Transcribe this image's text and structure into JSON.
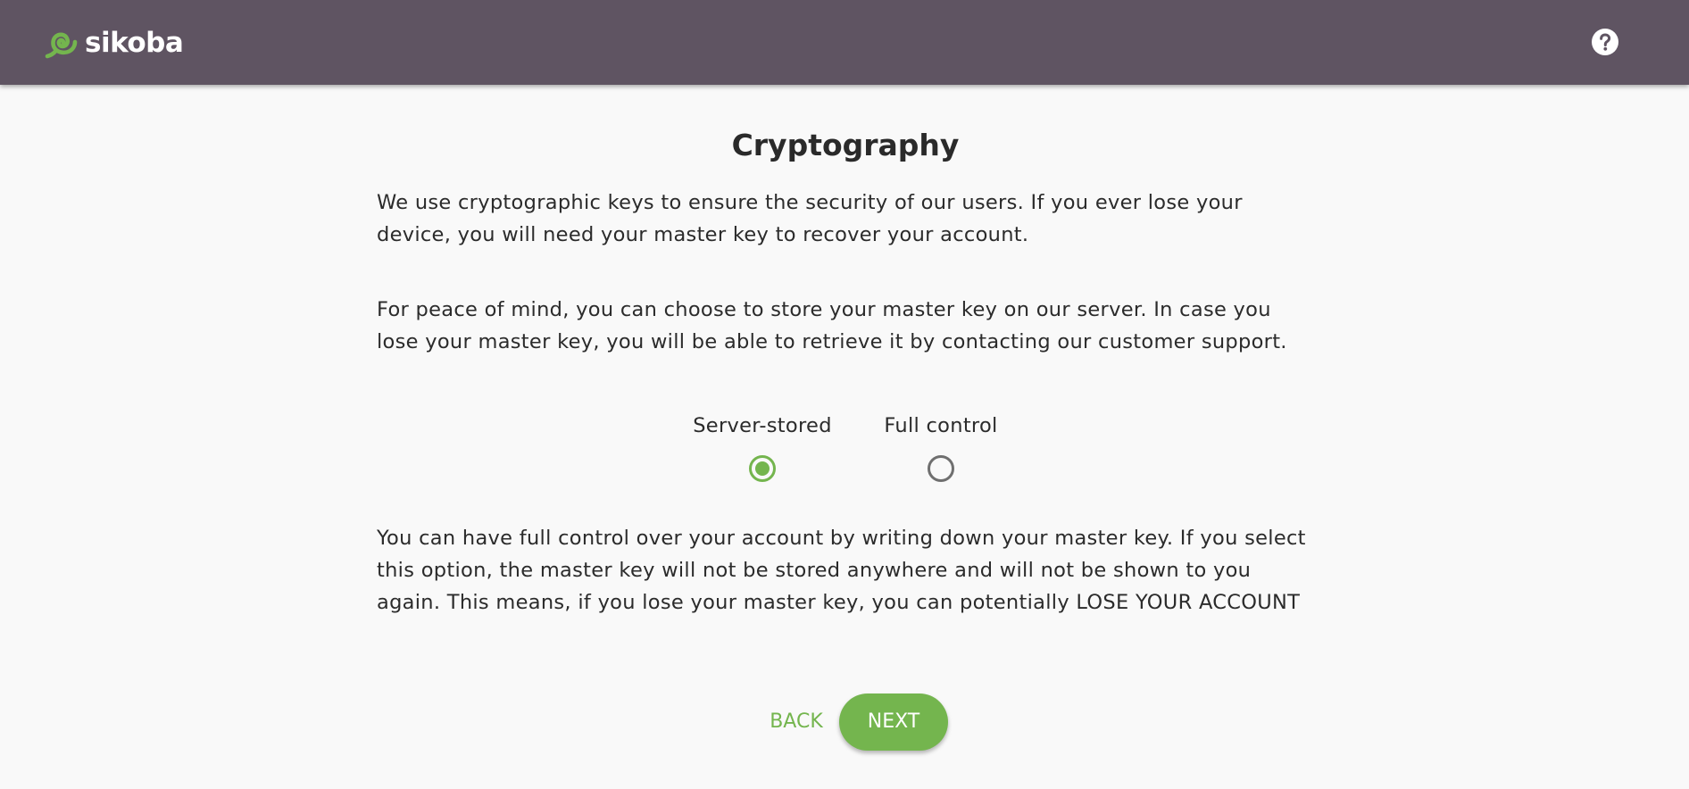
{
  "header": {
    "brand_name": "sikoba",
    "logo_icon": "swirl-logo-icon",
    "help_icon": "help-circle-icon"
  },
  "colors": {
    "appbar": "#5f5462",
    "accent": "#74b54e",
    "background": "#f9f9f9",
    "text": "#2b2b2b"
  },
  "main": {
    "title": "Cryptography",
    "intro": "We use cryptographic keys to ensure the security of our users. If you ever lose your device, you will need your master key to recover your account.",
    "server_info": "For peace of mind, you can choose to store your master key on our server. In case you lose your master key, you will be able to retrieve it by contacting our customer support.",
    "options": [
      {
        "label": "Server-stored",
        "selected": true
      },
      {
        "label": "Full control",
        "selected": false
      }
    ],
    "full_control_info": "You can have full control over your account by writing down your master key. If you select this option, the master key will not be stored anywhere and will not be shown to you again. This means, if you lose your master key, you can potentially LOSE YOUR ACCOUNT"
  },
  "actions": {
    "back_label": "BACK",
    "next_label": "NEXT"
  }
}
